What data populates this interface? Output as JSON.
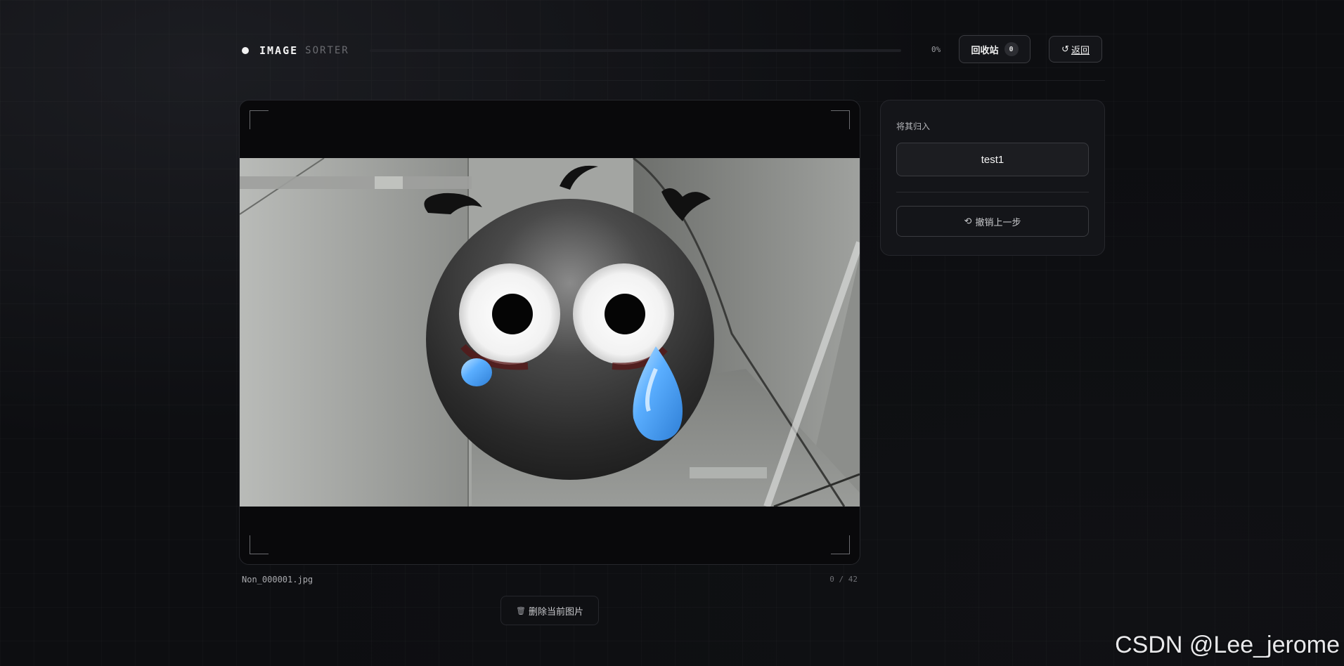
{
  "header": {
    "brand_main": "IMAGE",
    "brand_sub": "SORTER",
    "progress_percent": 0,
    "progress_text": "0%",
    "trash_label": "回收站",
    "trash_count": "0",
    "back_icon": "↺",
    "back_label": "返回"
  },
  "viewer": {
    "filename": "Non_000001.jpg",
    "counter": "0 / 42",
    "delete_icon": "🗑",
    "delete_label": "删除当前图片"
  },
  "panel": {
    "title": "将其归入",
    "categories": [
      "test1"
    ],
    "undo_icon": "⟲",
    "undo_label": "撤销上一步"
  },
  "watermark": "CSDN @Lee_jerome",
  "colors": {
    "background": "#0d0e11",
    "panel": "#141519",
    "border": "#3a3b40",
    "tear_blue": "#4aa3ff"
  }
}
